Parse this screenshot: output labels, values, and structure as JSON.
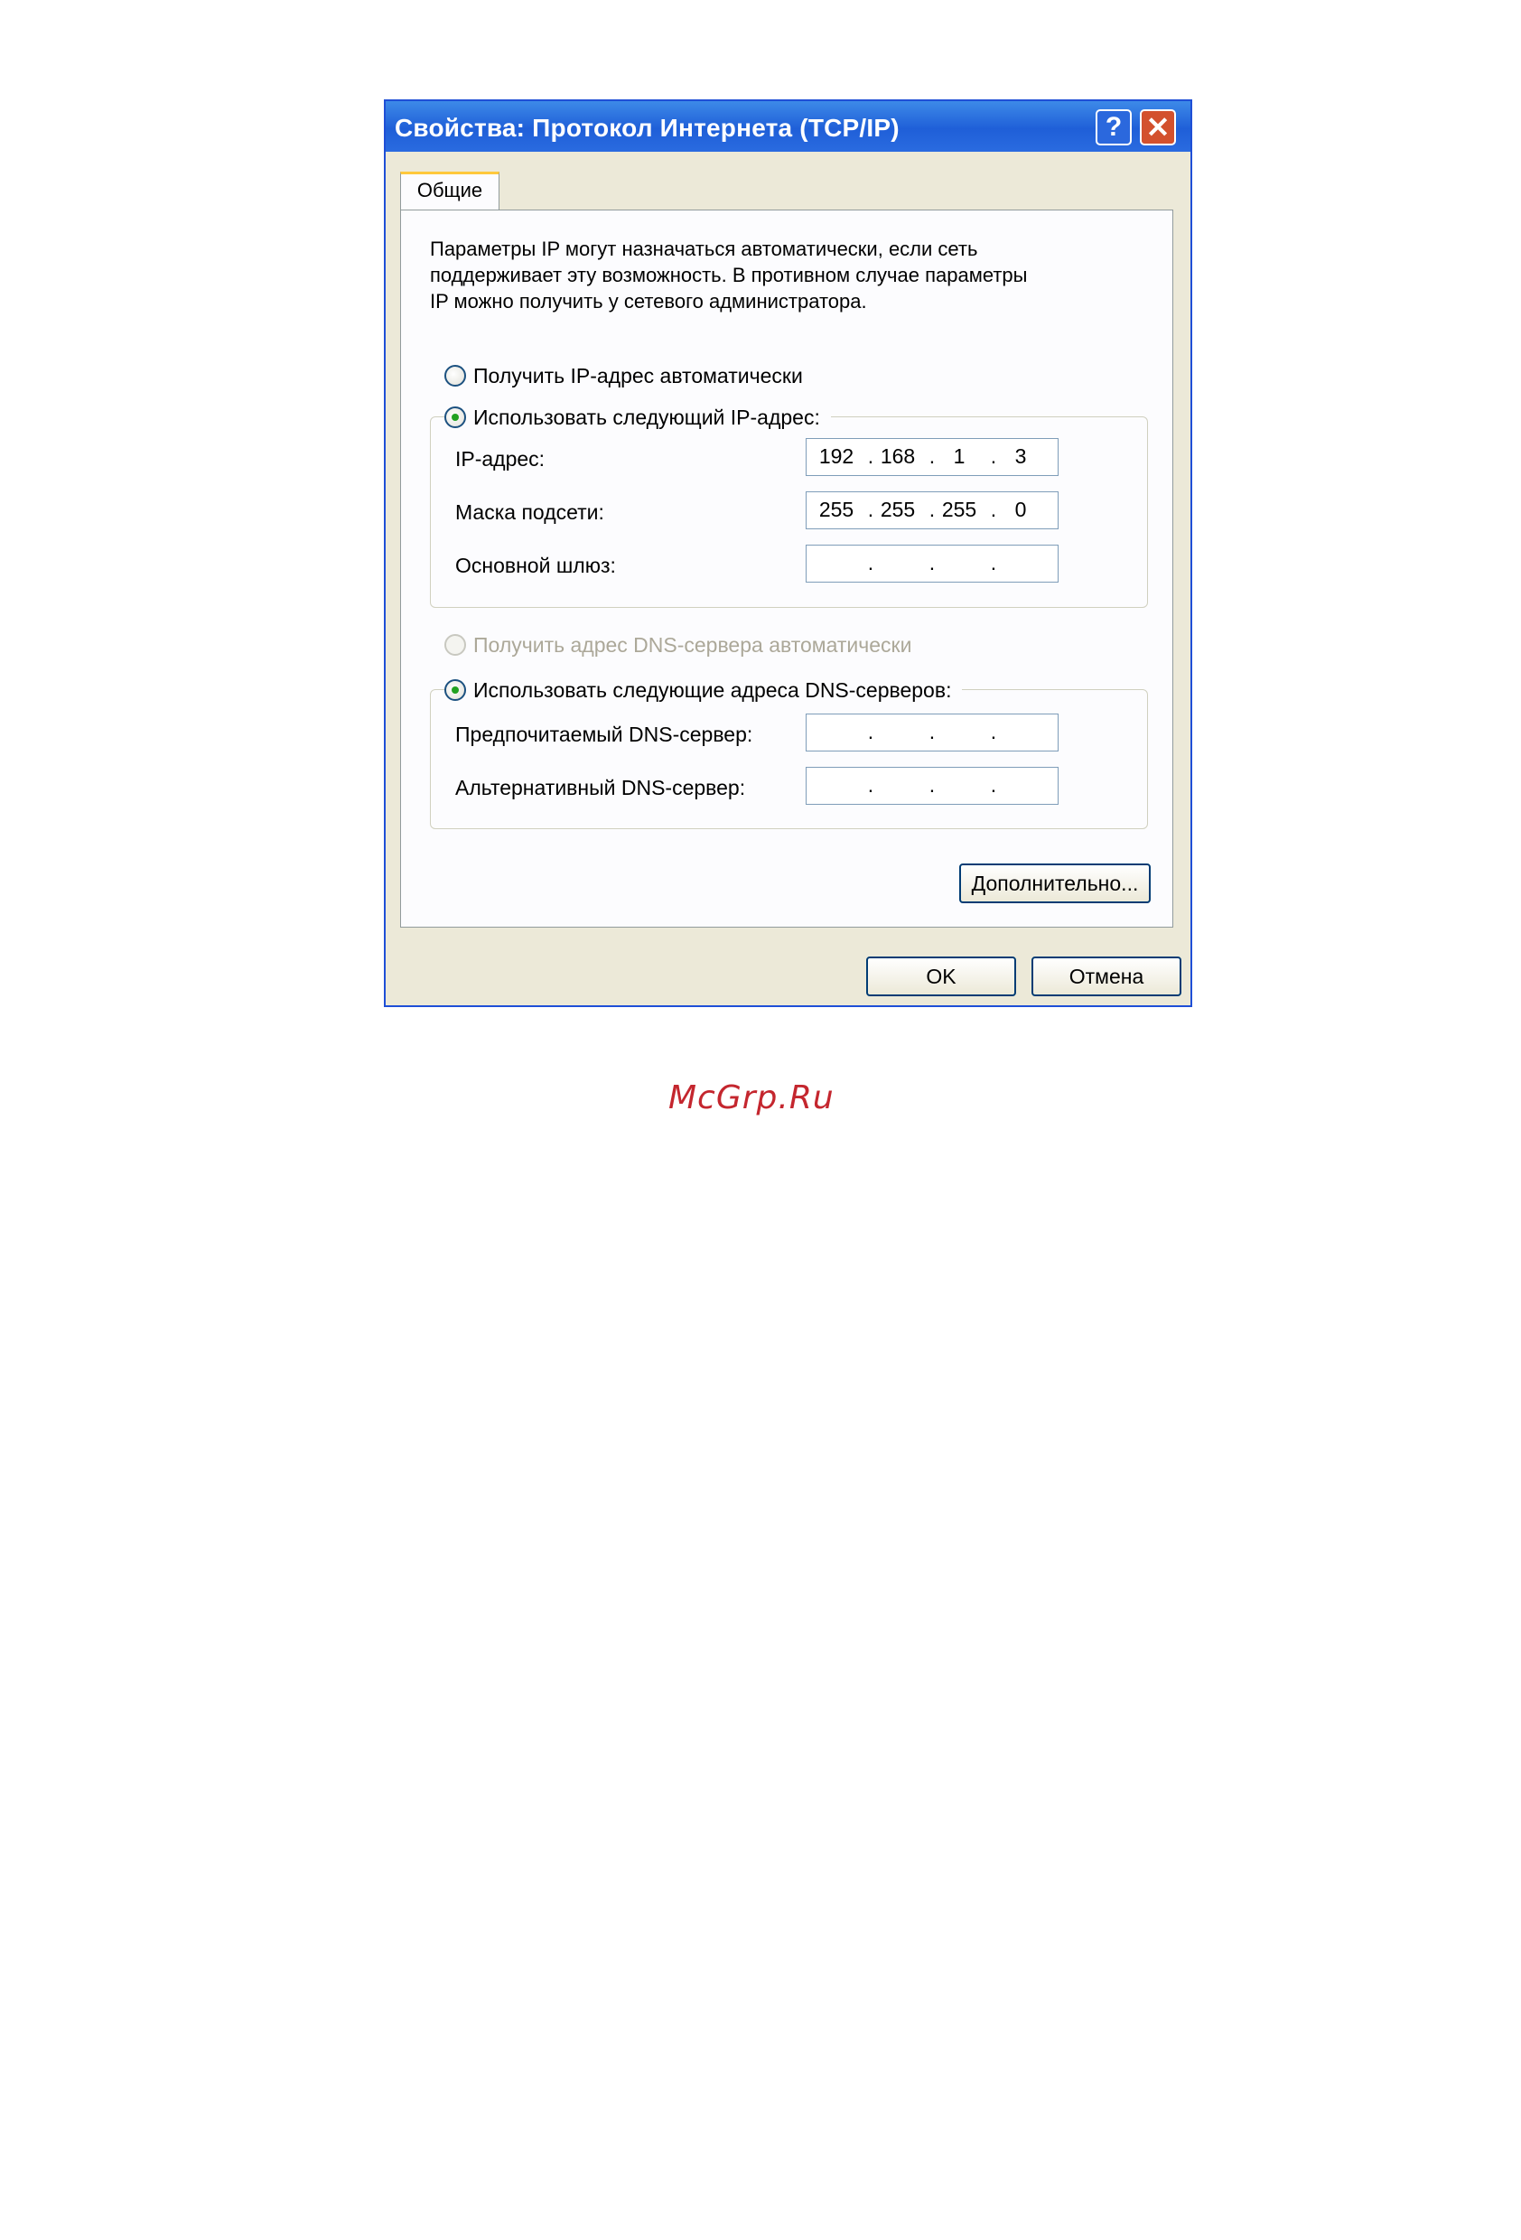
{
  "window": {
    "title": "Свойства: Протокол Интернета (TCP/IP)",
    "help_glyph": "?",
    "close_glyph": "✕"
  },
  "tabs": [
    {
      "label": "Общие",
      "active": true
    }
  ],
  "description": "Параметры IP могут назначаться автоматически, если сеть\nподдерживает эту возможность. В противном случае параметры\nIP можно получить у сетевого администратора.",
  "ip_section": {
    "auto_label": "Получить IP-адрес автоматически",
    "manual_label": "Использовать следующий IP-адрес:",
    "selected": "manual",
    "fields": [
      {
        "label": "IP-адрес:",
        "octets": [
          "192",
          "168",
          "1",
          "3"
        ]
      },
      {
        "label": "Маска подсети:",
        "octets": [
          "255",
          "255",
          "255",
          "0"
        ]
      },
      {
        "label": "Основной шлюз:",
        "octets": [
          "",
          "",
          "",
          ""
        ]
      }
    ]
  },
  "dns_section": {
    "auto_label": "Получить адрес DNS-сервера автоматически",
    "auto_disabled": true,
    "manual_label": "Использовать следующие адреса DNS-серверов:",
    "selected": "manual",
    "fields": [
      {
        "label": "Предпочитаемый DNS-сервер:",
        "octets": [
          "",
          "",
          "",
          ""
        ]
      },
      {
        "label": "Альтернативный DNS-сервер:",
        "octets": [
          "",
          "",
          "",
          ""
        ]
      }
    ]
  },
  "buttons": {
    "advanced": "Дополнительно...",
    "ok": "OK",
    "cancel": "Отмена"
  },
  "separator": ".",
  "watermark": "McGrp.Ru",
  "colors": {
    "titlebar": "#2a6be0",
    "close_button": "#d3512e",
    "radio_checked": "#21a121",
    "watermark": "#c4262e"
  }
}
